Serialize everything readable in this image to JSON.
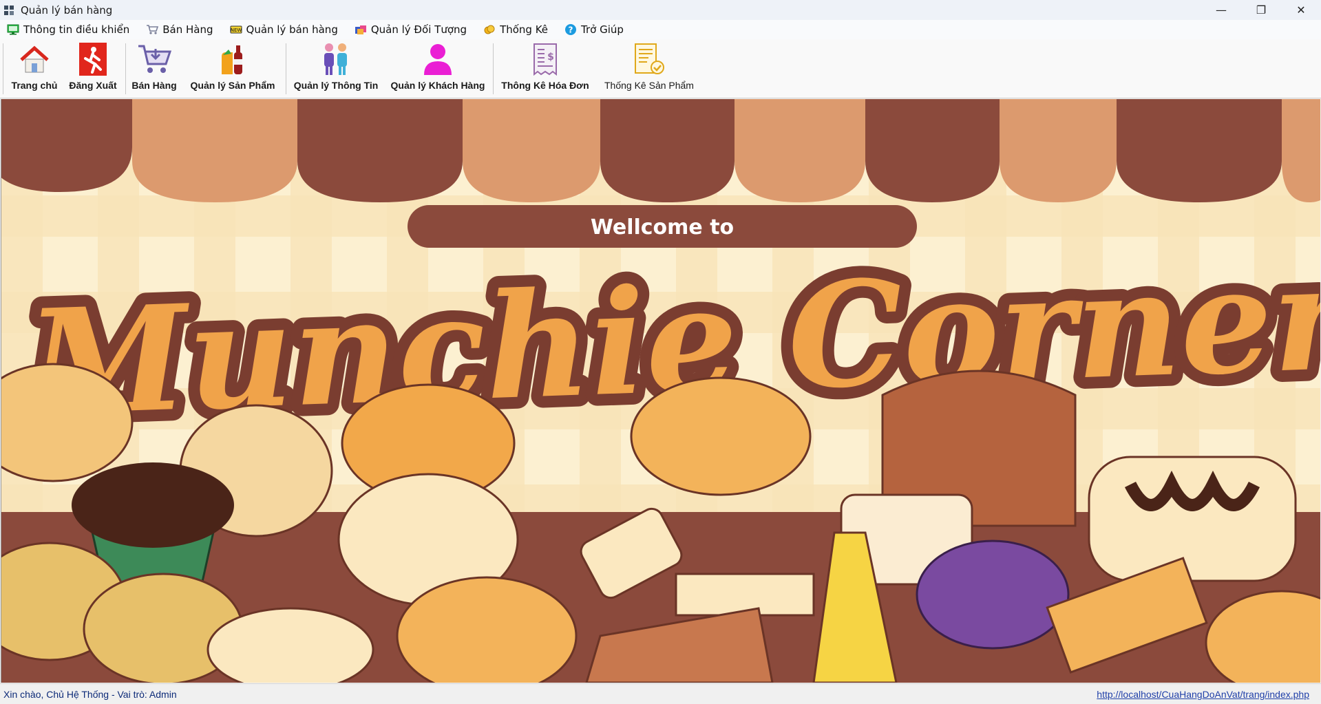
{
  "window": {
    "title": "Quản lý bán hàng",
    "minimize_glyph": "—",
    "restore_glyph": "❐",
    "close_glyph": "✕"
  },
  "menu": [
    {
      "label": "Thông tin điều khiển",
      "icon": "monitor-icon"
    },
    {
      "label": "Bán Hàng",
      "icon": "cart-icon"
    },
    {
      "label": "Quản lý bán hàng",
      "icon": "sale-tag-icon"
    },
    {
      "label": "Quản lý Đối Tượng",
      "icon": "people-icon"
    },
    {
      "label": "Thống Kê",
      "icon": "coins-icon"
    },
    {
      "label": "Trở Giúp",
      "icon": "help-icon"
    }
  ],
  "toolbar": [
    {
      "label": "Trang chủ",
      "icon": "home-icon"
    },
    {
      "label": "Đăng Xuất",
      "icon": "exit-icon"
    },
    {
      "label": "Bán Hàng",
      "icon": "cart-icon"
    },
    {
      "label": "Quản lý Sản Phẩm",
      "icon": "products-icon"
    },
    {
      "label": "Quản lý Thông Tin",
      "icon": "staff-icon"
    },
    {
      "label": "Quản lý Khách Hàng",
      "icon": "customer-icon"
    },
    {
      "label": "Thông Kê Hóa Đơn",
      "icon": "invoice-icon"
    },
    {
      "label": "Thống Kê Sản Phẩm",
      "icon": "product-report-icon"
    }
  ],
  "banner": {
    "welcome": "Wellcome to",
    "brand": "Munchie Corner",
    "colors": {
      "awning_dark": "#8b4a3c",
      "awning_light": "#dc9a6e",
      "background": "#fbecc6",
      "brand_fill": "#f0a34a",
      "outline": "#7a3d30"
    }
  },
  "status": {
    "greeting": "Xin chào, Chủ Hệ Thống - Vai trò: Admin",
    "link": "http://localhost/CuaHangDoAnVat/trang/index.php"
  }
}
